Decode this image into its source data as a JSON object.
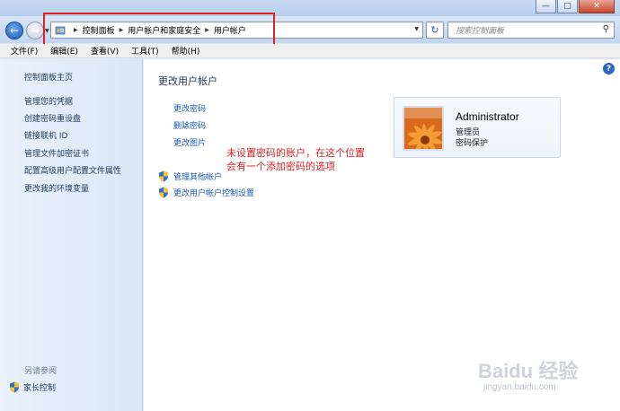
{
  "window": {
    "minimize_icon": "minimize-icon",
    "maximize_icon": "maximize-icon",
    "close_icon": "close-icon"
  },
  "address": {
    "crumbs": [
      "控制面板",
      "用户帐户和家庭安全",
      "用户帐户"
    ],
    "search_placeholder": "搜索控制面板"
  },
  "menu": [
    "文件(F)",
    "编辑(E)",
    "查看(V)",
    "工具(T)",
    "帮助(H)"
  ],
  "sidebar": {
    "home": "控制面板主页",
    "links": [
      "管理您的凭据",
      "创建密码重设盘",
      "链接联机 ID",
      "管理文件加密证书",
      "配置高级用户配置文件属性",
      "更改我的环境变量"
    ],
    "see_also": "另请参阅",
    "parental": "家长控制"
  },
  "main": {
    "title": "更改用户帐户",
    "tasks": [
      "更改密码",
      "删除密码",
      "更改图片"
    ],
    "shield_tasks": [
      "管理其他帐户",
      "更改用户帐户控制设置"
    ]
  },
  "annotation": {
    "line1": "未设置密码的账户，在这个位置",
    "line2": "会有一个添加密码的选项"
  },
  "user": {
    "name": "Administrator",
    "role": "管理员",
    "status": "密码保护"
  },
  "watermark": {
    "brand": "Baidu 经验",
    "url": "jingyan.baidu.com"
  },
  "colors": {
    "link": "#1d58b3",
    "annotation": "#e01e1e",
    "highlight_box": "#e02020"
  }
}
